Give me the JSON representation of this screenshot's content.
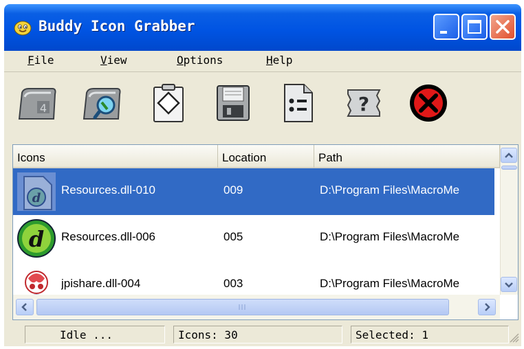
{
  "window": {
    "title": "Buddy Icon Grabber",
    "title_icon": "smiley-icon"
  },
  "controls": {
    "minimize": "minimize-icon",
    "maximize": "maximize-icon",
    "close": "close-x-icon"
  },
  "menu": {
    "file": {
      "accel": "F",
      "rest": "ile"
    },
    "view": {
      "accel": "V",
      "rest": "iew"
    },
    "options": {
      "accel": "O",
      "rest": "ptions"
    },
    "help": {
      "accel": "H",
      "rest": "elp"
    }
  },
  "toolbar": [
    "open-folder-icon",
    "search-folder-icon",
    "clipboard-icon",
    "save-disk-icon",
    "properties-icon",
    "help-question-icon",
    "stop-icon"
  ],
  "list": {
    "columns": {
      "icons": "Icons",
      "location": "Location",
      "path": "Path"
    },
    "rows": [
      {
        "name": "Resources.dll-010",
        "location": "009",
        "path": "D:\\Program Files\\MacroMe",
        "selected": true,
        "icon": "dreamweaver-icon"
      },
      {
        "name": "Resources.dll-006",
        "location": "005",
        "path": "D:\\Program Files\\MacroMe",
        "selected": false,
        "icon": "dreamweaver-icon"
      },
      {
        "name": "jpishare.dll-004",
        "location": "003",
        "path": "D:\\Program Files\\MacroMe",
        "selected": false,
        "icon": "share-icon"
      }
    ]
  },
  "status": {
    "state": "Idle ...",
    "icons": "Icons: 30",
    "selected": "Selected: 1"
  },
  "colors": {
    "title_blue": "#0054e3",
    "selection": "#316ac5",
    "close_red": "#e1502d",
    "window_face": "#ece9d8"
  }
}
